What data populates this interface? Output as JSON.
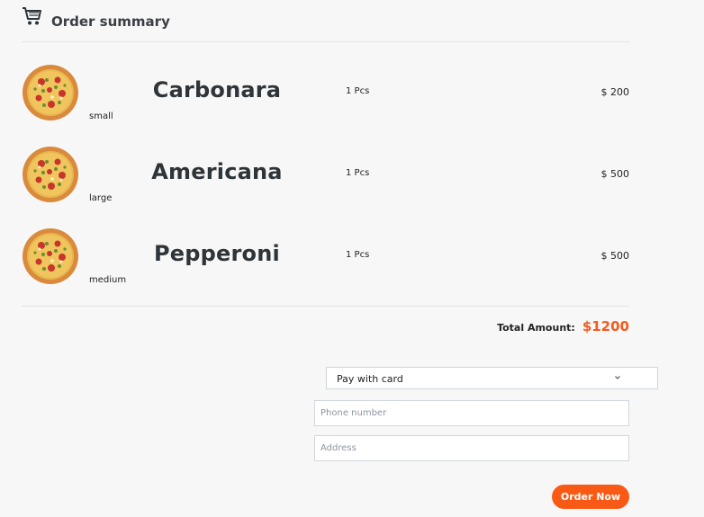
{
  "header": {
    "title": "Order summary",
    "icon": "cart-icon"
  },
  "items": [
    {
      "name": "Carbonara",
      "size": "small",
      "qty": "1 Pcs",
      "price": "$ 200"
    },
    {
      "name": "Americana",
      "size": "large",
      "qty": "1 Pcs",
      "price": "$ 500"
    },
    {
      "name": "Pepperoni",
      "size": "medium",
      "qty": "1 Pcs",
      "price": "$ 500"
    }
  ],
  "total": {
    "label": "Total Amount:",
    "value": "$1200"
  },
  "payment": {
    "selected": "Pay with card"
  },
  "form": {
    "phone_placeholder": "Phone number",
    "address_placeholder": "Address"
  },
  "actions": {
    "order_label": "Order Now"
  },
  "colors": {
    "accent": "#f85a16",
    "total": "#f25b1d"
  }
}
